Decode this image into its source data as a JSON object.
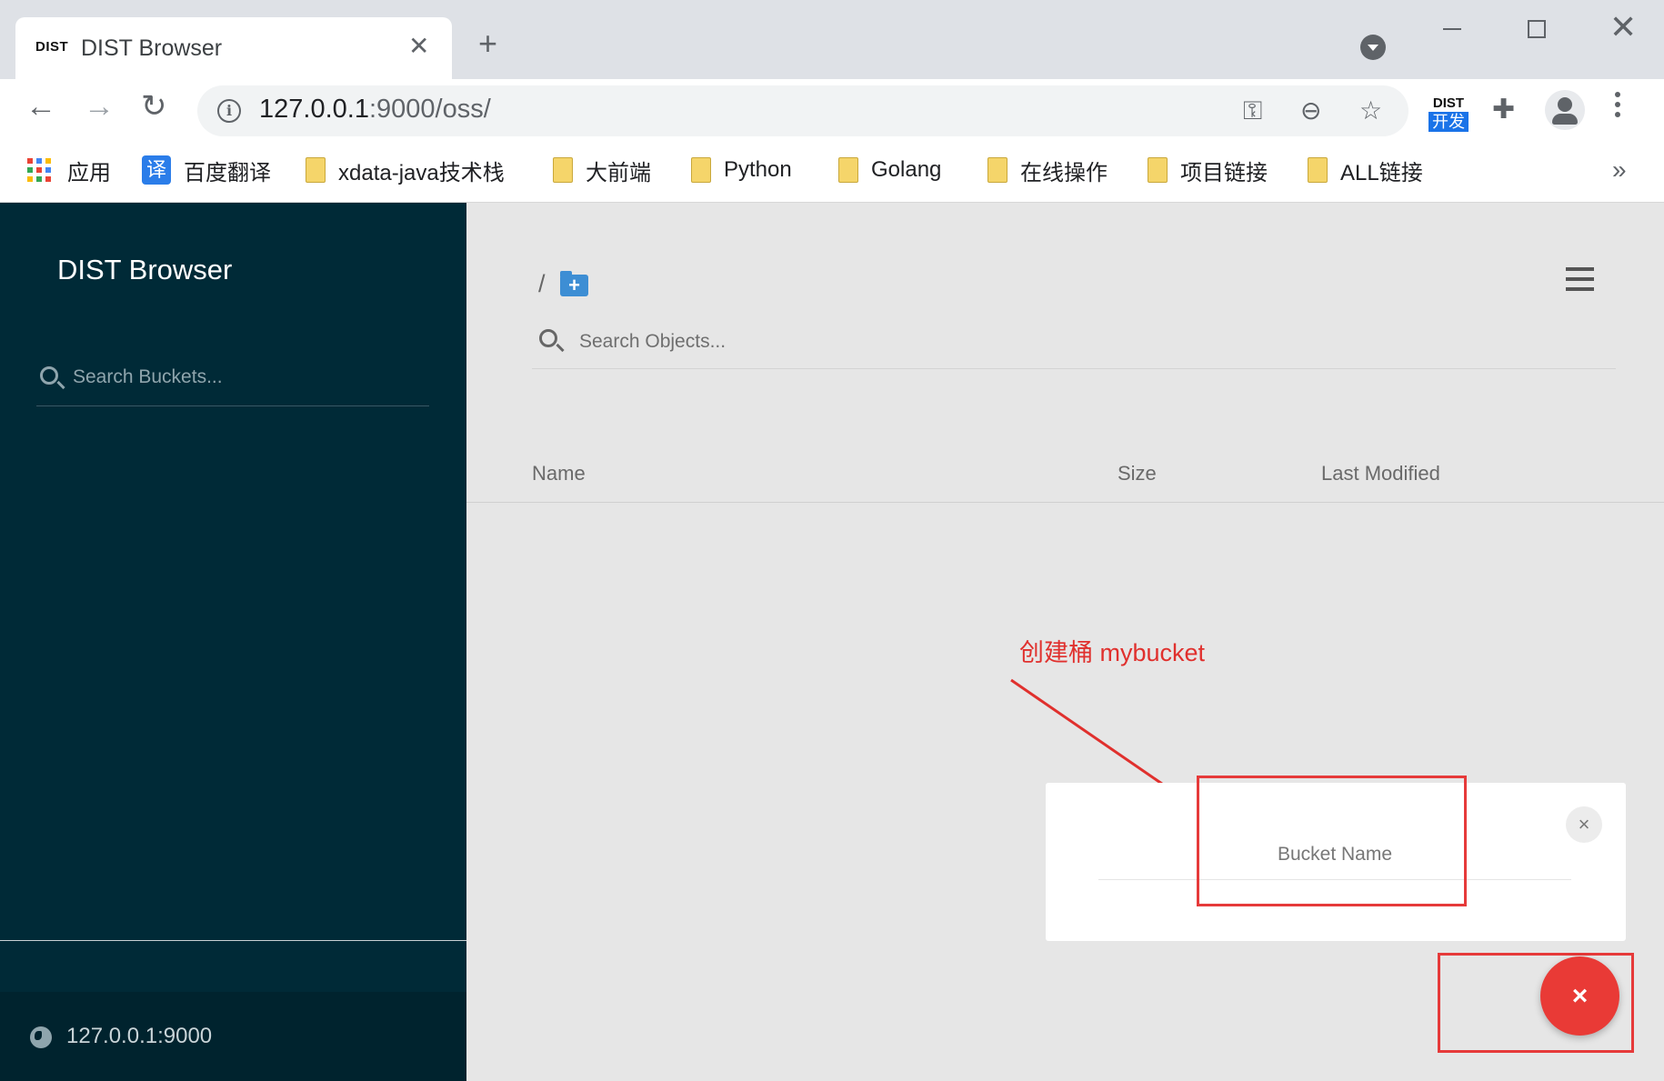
{
  "browser": {
    "tab_logo": "DIST",
    "tab_title": "DIST Browser",
    "tab_close": "✕",
    "new_tab": "+",
    "url_host": "127.0.0.1",
    "url_rest": ":9000/oss/",
    "ext_top": "DIST",
    "ext_bottom": "开发",
    "bookmarks": [
      {
        "label": "应用",
        "icon": "apps-grid-icon"
      },
      {
        "label": "百度翻译",
        "icon": "translate-icon",
        "icon_text": "译"
      },
      {
        "label": "xdata-java技术栈",
        "icon": "folder-icon"
      },
      {
        "label": "大前端",
        "icon": "folder-icon"
      },
      {
        "label": "Python",
        "icon": "folder-icon"
      },
      {
        "label": "Golang",
        "icon": "folder-icon"
      },
      {
        "label": "在线操作",
        "icon": "folder-icon"
      },
      {
        "label": "项目链接",
        "icon": "folder-icon"
      },
      {
        "label": "ALL链接",
        "icon": "folder-icon"
      }
    ],
    "more": "»"
  },
  "sidebar": {
    "brand": "DIST Browser",
    "search_placeholder": "Search Buckets...",
    "host": "127.0.0.1:9000"
  },
  "main": {
    "breadcrumb": "/",
    "search_placeholder": "Search Objects...",
    "columns": {
      "name": "Name",
      "size": "Size",
      "modified": "Last Modified"
    }
  },
  "annotation": "创建桶 mybucket",
  "modal": {
    "close": "×",
    "input_placeholder": "Bucket Name",
    "input_value": ""
  },
  "fab_label": "×",
  "colors": {
    "sidebar": "#002a37",
    "accent_red": "#e93a36",
    "folder_blue": "#3d8ed4"
  }
}
